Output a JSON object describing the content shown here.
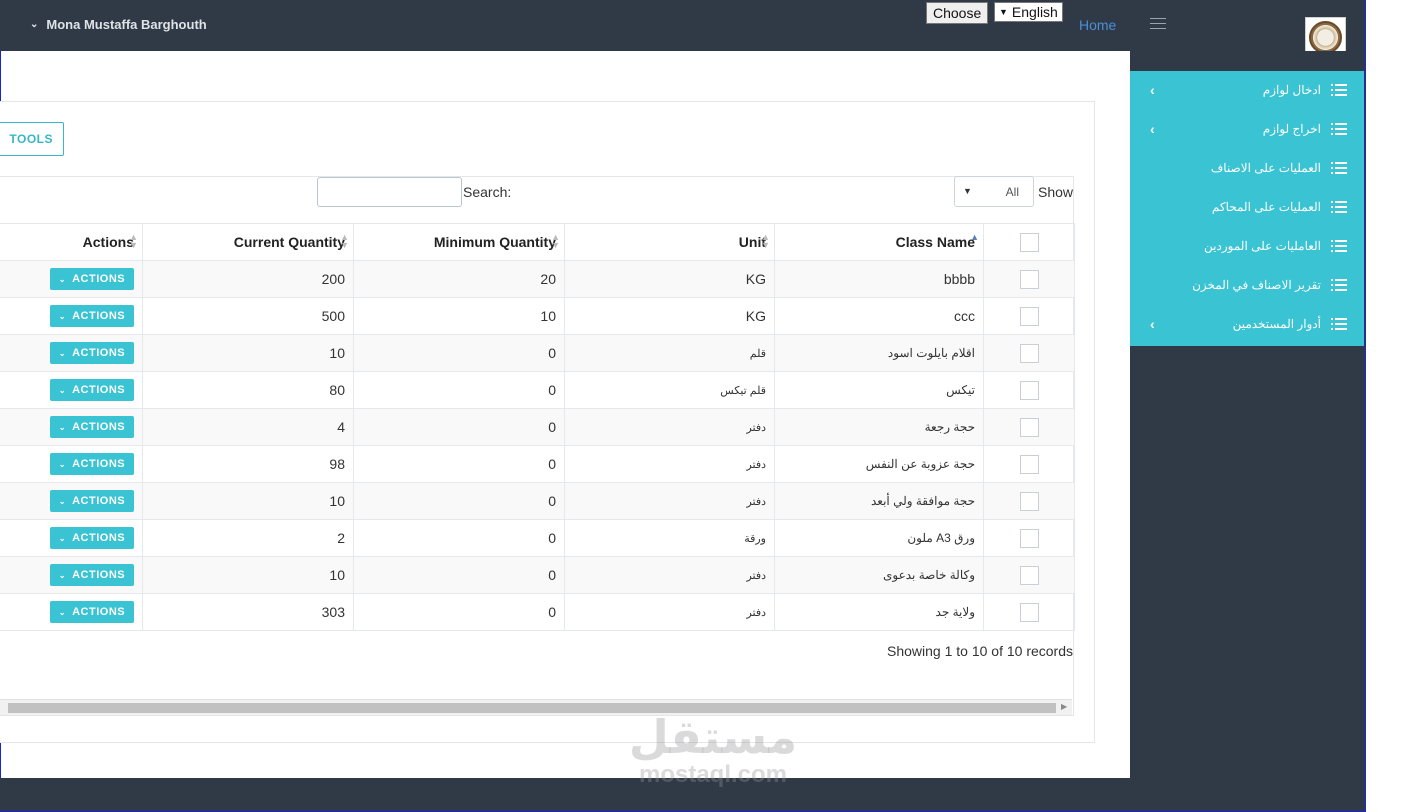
{
  "header": {
    "user_name": "Mona Mustaffa Barghouth",
    "choose_label": "Choose",
    "language": "English",
    "home_label": "Home"
  },
  "sidebar": {
    "items": [
      {
        "label": "ادخال لوازم",
        "has_children": true
      },
      {
        "label": "اخراج لوازم",
        "has_children": true
      },
      {
        "label": "العمليات على الاصناف",
        "has_children": false
      },
      {
        "label": "العمليات على المحاكم",
        "has_children": false
      },
      {
        "label": "العامليات على الموردين",
        "has_children": false
      },
      {
        "label": "تقرير الاصناف في المخزن",
        "has_children": false
      },
      {
        "label": "أدوار المستخدمين",
        "has_children": true
      }
    ]
  },
  "toolbar": {
    "tools_label": "TOOLS",
    "show_label": "Show",
    "show_value": "All",
    "search_label": "Search:",
    "search_value": ""
  },
  "table": {
    "columns": {
      "class_name": "Class Name",
      "unit": "Unit",
      "minimum_quantity": "Minimum Quantity",
      "current_quantity": "Current Quantity",
      "actions": "Actions"
    },
    "action_label": "ACTIONS",
    "rows": [
      {
        "class_name": "bbbb",
        "unit": "KG",
        "minimum_quantity": "20",
        "current_quantity": "200"
      },
      {
        "class_name": "ccc",
        "unit": "KG",
        "minimum_quantity": "10",
        "current_quantity": "500"
      },
      {
        "class_name": "اقلام بايلوت اسود",
        "unit": "قلم",
        "minimum_quantity": "0",
        "current_quantity": "10"
      },
      {
        "class_name": "تيكس",
        "unit": "قلم تيكس",
        "minimum_quantity": "0",
        "current_quantity": "80"
      },
      {
        "class_name": "حجة رجعة",
        "unit": "دفتر",
        "minimum_quantity": "0",
        "current_quantity": "4"
      },
      {
        "class_name": "حجة عزوبة عن النفس",
        "unit": "دفتر",
        "minimum_quantity": "0",
        "current_quantity": "98"
      },
      {
        "class_name": "حجة موافقة ولي أبعد",
        "unit": "دفتر",
        "minimum_quantity": "0",
        "current_quantity": "10"
      },
      {
        "class_name": "ورق A3 ملون",
        "unit": "ورقة",
        "minimum_quantity": "0",
        "current_quantity": "2"
      },
      {
        "class_name": "وكالة خاصة بدعوى",
        "unit": "دفتر",
        "minimum_quantity": "0",
        "current_quantity": "10"
      },
      {
        "class_name": "ولاية جد",
        "unit": "دفتر",
        "minimum_quantity": "0",
        "current_quantity": "303"
      }
    ]
  },
  "footer": {
    "records_text": "Showing 1 to 10 of 10 records"
  },
  "watermark": {
    "arabic": "مستقل",
    "latin": "mostaql.com"
  }
}
